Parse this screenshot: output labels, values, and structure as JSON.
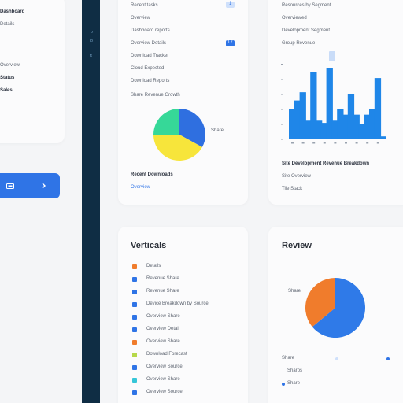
{
  "colors": {
    "accent": "#2f74e6",
    "navy": "#0f2d44",
    "pie_teal": "#36d898",
    "pie_blue": "#2f6fe0",
    "pie_yellow": "#f7e53b",
    "pie_orange": "#f07c2c",
    "bar_blue": "#1f86e8"
  },
  "left_card": {
    "title": "Dashboard",
    "subtitle": "Details",
    "label_1": "Overview",
    "label_2": "Status"
  },
  "left_button": {
    "icon": "folder-icon",
    "chevron": "chevron-right-icon"
  },
  "nav_rail": {
    "item_1": "o",
    "item_2": "lo",
    "item_3": "ft"
  },
  "card_top_mid": {
    "rows": [
      "Recent tasks",
      "Overview",
      "Dashboard reports",
      "Overview Details",
      "Download Tracker",
      "Cloud Expected",
      "Download Reports"
    ],
    "legend_line": "Share Revenue Growth",
    "pie_label": "Share",
    "footer_bold": "Recent Downloads",
    "footer_link": "Overview",
    "badge_1": "1",
    "badge_2": "17"
  },
  "card_top_right": {
    "rows": [
      "Resources by Segment",
      "Overviewed",
      "Development Segment",
      "Group Revenue"
    ],
    "footer_bold": "Site Development Revenue Breakdown",
    "footer_sub": "Site Overview",
    "footer_small": "Tile Stack"
  },
  "card_bottom_mid": {
    "title": "Verticals",
    "items": [
      "Details",
      "Revenue Share",
      "Revenue Share",
      "Device Breakdown by Source",
      "Overview Share",
      "Overview Detail",
      "Overview Share",
      "Download Forecast",
      "Overview Source",
      "Overview Share",
      "Overview Source"
    ]
  },
  "card_bottom_right": {
    "title": "Review",
    "pie_label": "Share",
    "legend_1": "Share",
    "legend_2": "Sharps",
    "legend_3": "Share"
  },
  "chart_data": [
    {
      "type": "pie",
      "values": [
        33,
        42,
        25
      ],
      "colors": [
        "#2f6fe0",
        "#f7e53b",
        "#36d898"
      ]
    },
    {
      "type": "bar",
      "values": [
        40,
        52,
        63,
        25,
        90,
        25,
        22,
        95,
        25,
        40,
        33,
        60,
        33,
        20,
        33,
        40,
        82,
        4
      ],
      "ylim": [
        0,
        100
      ]
    },
    {
      "type": "pie",
      "values": [
        64,
        36
      ],
      "colors": [
        "#2f7ae8",
        "#f07c2c"
      ]
    }
  ]
}
